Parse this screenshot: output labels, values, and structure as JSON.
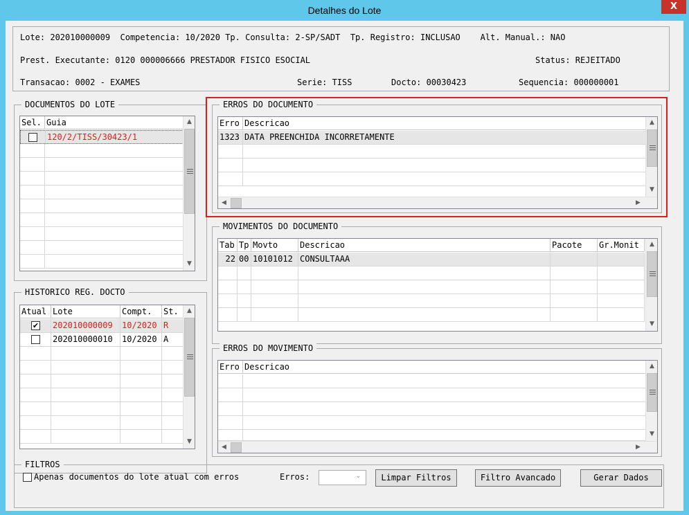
{
  "window": {
    "title": "Detalhes do Lote",
    "close_label": "X"
  },
  "header": {
    "line1": "Lote: 202010000009  Competencia: 10/2020 Tp. Consulta: 2-SP/SADT  Tp. Registro: INCLUSAO    Alt. Manual.: NAO",
    "prest": "Prest. Executante: 0120 000006666 PRESTADOR FISICO ESOCIAL",
    "status": "Status: REJEITADO",
    "transacao": "Transacao: 0002 - EXAMES",
    "serie": "Serie: TISS",
    "docto": "Docto: 00030423",
    "sequencia": "Sequencia: 000000001"
  },
  "documentos": {
    "title": "DOCUMENTOS DO LOTE",
    "columns": [
      "Sel.",
      "Guia"
    ],
    "rows": [
      {
        "selected": false,
        "guia": "120/2/TISS/30423/1"
      }
    ]
  },
  "erros_documento": {
    "title": "ERROS DO DOCUMENTO",
    "columns": [
      "Erro",
      "Descricao"
    ],
    "rows": [
      {
        "erro": "1323",
        "descricao": "DATA PREENCHIDA INCORRETAMENTE"
      }
    ]
  },
  "movimentos": {
    "title": "MOVIMENTOS DO DOCUMENTO",
    "columns": [
      "Tab",
      "Tp",
      "Movto",
      "Descricao",
      "Pacote",
      "Gr.Monit"
    ],
    "rows": [
      {
        "tab": "22",
        "tp": "00",
        "movto": "10101012",
        "descricao": "CONSULTAAA",
        "pacote": "",
        "grmonit": ""
      }
    ]
  },
  "historico": {
    "title": "HISTORICO REG. DOCTO",
    "columns": [
      "Atual",
      "Lote",
      "Compt.",
      "St."
    ],
    "rows": [
      {
        "atual": true,
        "lote": "202010000009",
        "compt": "10/2020",
        "st": "R"
      },
      {
        "atual": false,
        "lote": "202010000010",
        "compt": "10/2020",
        "st": "A"
      }
    ]
  },
  "erros_movimento": {
    "title": "ERROS DO MOVIMENTO",
    "columns": [
      "Erro",
      "Descricao"
    ]
  },
  "filtros": {
    "title": "FILTROS",
    "checkbox_label": "Apenas documentos do lote atual com erros",
    "erros_label": "Erros:",
    "erros_value": "",
    "limpar": "Limpar Filtros",
    "avancado": "Filtro Avancado",
    "gerar": "Gerar Dados"
  },
  "icons": {
    "check": "✔",
    "up": "▲",
    "down": "▼",
    "left": "◀",
    "right": "▶"
  },
  "colors": {
    "highlight": "#e01b1b",
    "title_bar": "#5fc7ea",
    "close": "#c7322b"
  }
}
